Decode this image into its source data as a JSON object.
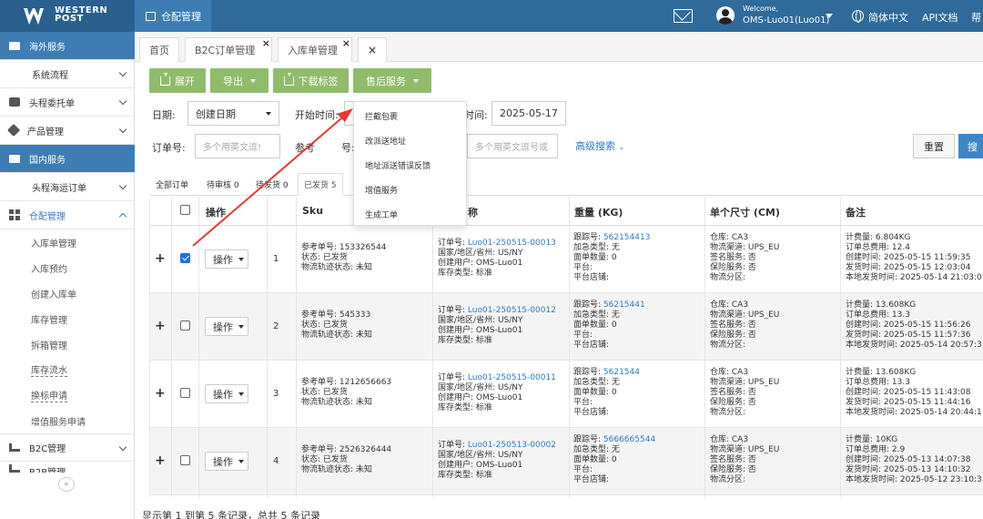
{
  "header": {
    "brand_line1": "WESTERN",
    "brand_line2": "POST",
    "module": "仓配管理",
    "welcome": "Welcome,",
    "username": "OMS-Luo01(Luo01)",
    "language": "简体中文",
    "api_docs": "API文档",
    "help_cut": "帮"
  },
  "sidebar": {
    "items": [
      {
        "label": "海外服务"
      },
      {
        "label": "系统流程"
      },
      {
        "label": "头程委托单"
      },
      {
        "label": "产品管理"
      },
      {
        "label": "国内服务"
      },
      {
        "label": "头程海运订单"
      },
      {
        "label": "仓配管理"
      },
      {
        "label": "入库单管理"
      },
      {
        "label": "入库预约"
      },
      {
        "label": "创建入库单"
      },
      {
        "label": "库存管理"
      },
      {
        "label": "拆箱管理"
      },
      {
        "label": "库存流水"
      },
      {
        "label": "换标申请"
      },
      {
        "label": "增值服务申请"
      },
      {
        "label": "B2C管理"
      },
      {
        "label": "B2B管理"
      }
    ],
    "collapse": "«"
  },
  "tabs": [
    {
      "label": "首页"
    },
    {
      "label": "B2C订单管理",
      "close": "×"
    },
    {
      "label": "入库单管理",
      "close": "×"
    },
    {
      "label": "",
      "close": "×"
    }
  ],
  "toolbar": {
    "expand": "展开",
    "export": "导出",
    "download_label": "下载标签",
    "after_sales": "售后服务"
  },
  "filters": {
    "date_label": "日期:",
    "date_type": "创建日期",
    "start_label": "开始时间:",
    "end_label_cut": "时间:",
    "end_value": "2025-05-17",
    "order_label": "订单号:",
    "order_ph": "多个用英文逗!",
    "ref_label_a": "参考",
    "ref_label_b": "号:",
    "tracking_ph": "多个用英文逗号或",
    "advanced": "高级搜索",
    "reset": "重置",
    "search_cut": "搜"
  },
  "status_tabs": [
    {
      "label": "全部订单"
    },
    {
      "label": "待审核 0"
    },
    {
      "label": "待发货 0"
    },
    {
      "label": "已发货 5"
    }
  ],
  "table": {
    "headers": {
      "op": "操作",
      "sku": "Sku",
      "name_cut": "称",
      "weight": "重量 (KG)",
      "size": "单个尺寸 (CM)",
      "remark": "备注"
    },
    "op_btn": "操作",
    "rows": [
      {
        "seq": "1",
        "checked": true,
        "sku": [
          "参考单号: 153326544",
          "状态: 已发货",
          "物流轨迹状态: 未知"
        ],
        "order_prefix": "订单号: ",
        "order_no": "Luo01-250515-00013",
        "order": [
          "国家/地区/省州: US/NY",
          "创建用户: OMS-Luo01",
          "库存类型: 标准"
        ],
        "trk_prefix": "跟踪号: ",
        "trk_no": "562154413",
        "trk": [
          "加急类型: 无",
          "面单数量: 0",
          "平台:",
          "平台店铺:"
        ],
        "wh": [
          "仓库: CA3",
          "物流渠道: UPS_EU",
          "签名服务: 否",
          "保险服务: 否",
          "物流分区:"
        ],
        "rm": [
          "计费量: 6.804KG",
          "订单总费用: 12.4",
          "创建时间: 2025-05-15 11:59:35",
          "发货时间: 2025-05-15 12:03:04",
          "本地发货时间: 2025-05-14 21:03:0"
        ]
      },
      {
        "seq": "2",
        "checked": false,
        "sku": [
          "参考单号: 545333",
          "状态: 已发货",
          "物流轨迹状态: 未知"
        ],
        "order_prefix": "订单号: ",
        "order_no": "Luo01-250515-00012",
        "order": [
          "国家/地区/省州: US/NY",
          "创建用户: OMS-Luo01",
          "库存类型: 标准"
        ],
        "trk_prefix": "跟踪号: ",
        "trk_no": "56215441",
        "trk": [
          "加急类型: 无",
          "面单数量: 0",
          "平台:",
          "平台店铺:"
        ],
        "wh": [
          "仓库: CA3",
          "物流渠道: UPS_EU",
          "签名服务: 否",
          "保险服务: 否",
          "物流分区:"
        ],
        "rm": [
          "计费量: 13.608KG",
          "订单总费用: 13.3",
          "创建时间: 2025-05-15 11:56:26",
          "发货时间: 2025-05-15 11:57:36",
          "本地发货时间: 2025-05-14 20:57:3"
        ]
      },
      {
        "seq": "3",
        "checked": false,
        "sku": [
          "参考单号: 1212656663",
          "状态: 已发货",
          "物流轨迹状态: 未知"
        ],
        "order_prefix": "订单号: ",
        "order_no": "Luo01-250515-00011",
        "order": [
          "国家/地区/省州: US/NY",
          "创建用户: OMS-Luo01",
          "库存类型: 标准"
        ],
        "trk_prefix": "跟踪号: ",
        "trk_no": "5621544",
        "trk": [
          "加急类型: 无",
          "面单数量: 0",
          "平台:",
          "平台店铺:"
        ],
        "wh": [
          "仓库: CA3",
          "物流渠道: UPS_EU",
          "签名服务: 否",
          "保险服务: 否",
          "物流分区:"
        ],
        "rm": [
          "计费量: 13.608KG",
          "订单总费用: 13.3",
          "创建时间: 2025-05-15 11:43:08",
          "发货时间: 2025-05-15 11:44:16",
          "本地发货时间: 2025-05-14 20:44:1"
        ]
      },
      {
        "seq": "4",
        "checked": false,
        "sku": [
          "参考单号: 2526326444",
          "状态: 已发货",
          "物流轨迹状态: 未知"
        ],
        "order_prefix": "订单号: ",
        "order_no": "Luo01-250513-00002",
        "order": [
          "国家/地区/省州: US/NY",
          "创建用户: OMS-Luo01",
          "库存类型: 标准"
        ],
        "trk_prefix": "跟踪号: ",
        "trk_no": "5666665544",
        "trk": [
          "加急类型: 无",
          "面单数量: 0",
          "平台:",
          "平台店铺:"
        ],
        "wh": [
          "仓库: CA3",
          "物流渠道: UPS_EU",
          "签名服务: 否",
          "保险服务: 否",
          "物流分区:"
        ],
        "rm": [
          "计费量: 10KG",
          "订单总费用: 2.9",
          "创建时间: 2025-05-13 14:07:38",
          "发货时间: 2025-05-13 14:10:32",
          "本地发货时间: 2025-05-12 23:10:3"
        ]
      }
    ]
  },
  "dropdown": {
    "items": [
      {
        "label": "拦截包裹"
      },
      {
        "label": "改派送地址"
      },
      {
        "label": "地址派送错误反馈"
      },
      {
        "label": "增值服务"
      },
      {
        "label": "生成工单"
      }
    ]
  },
  "footer": {
    "summary": "显示第 1 到第 5 条记录，总共 5 条记录"
  },
  "colors": {
    "header": "#2f6a9b",
    "section": "#3d7db4",
    "green_btn": "#8fbc6a",
    "link": "#2a7bc4",
    "arrow": "#e53935"
  }
}
